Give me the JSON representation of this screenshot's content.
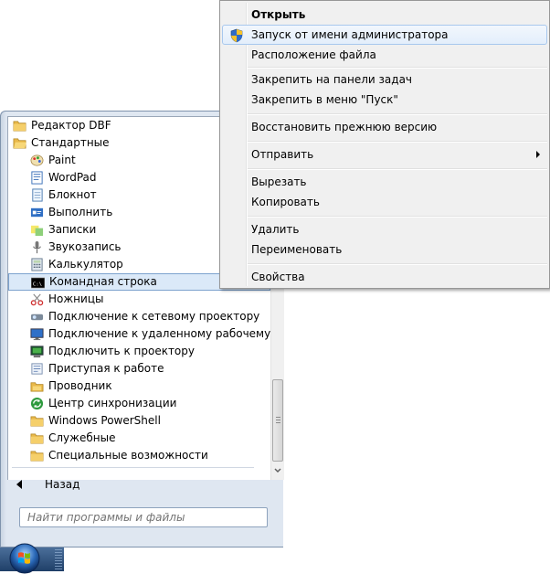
{
  "program_list": {
    "items": [
      {
        "label": "Редактор DBF",
        "kind": "folder",
        "icon": "folder-icon"
      },
      {
        "label": "Стандартные",
        "kind": "folder",
        "icon": "folder-open-icon"
      },
      {
        "label": "Paint",
        "kind": "app",
        "icon": "paint-icon"
      },
      {
        "label": "WordPad",
        "kind": "app",
        "icon": "wordpad-icon"
      },
      {
        "label": "Блокнот",
        "kind": "app",
        "icon": "notepad-icon"
      },
      {
        "label": "Выполнить",
        "kind": "app",
        "icon": "run-icon"
      },
      {
        "label": "Записки",
        "kind": "app",
        "icon": "sticky-notes-icon"
      },
      {
        "label": "Звукозапись",
        "kind": "app",
        "icon": "microphone-icon"
      },
      {
        "label": "Калькулятор",
        "kind": "app",
        "icon": "calculator-icon"
      },
      {
        "label": "Командная строка",
        "kind": "app",
        "icon": "cmd-icon",
        "selected": true
      },
      {
        "label": "Ножницы",
        "kind": "app",
        "icon": "scissors-icon"
      },
      {
        "label": "Подключение к сетевому проектору",
        "kind": "app",
        "icon": "projector-network-icon"
      },
      {
        "label": "Подключение к удаленному рабочему столу",
        "kind": "app",
        "icon": "remote-desktop-icon"
      },
      {
        "label": "Подключить к проектору",
        "kind": "app",
        "icon": "projector-icon"
      },
      {
        "label": "Приступая к работе",
        "kind": "app",
        "icon": "getting-started-icon"
      },
      {
        "label": "Проводник",
        "kind": "app",
        "icon": "explorer-icon"
      },
      {
        "label": "Центр синхронизации",
        "kind": "app",
        "icon": "sync-center-icon"
      },
      {
        "label": "Windows PowerShell",
        "kind": "app",
        "icon": "folder-icon"
      },
      {
        "label": "Служебные",
        "kind": "app",
        "icon": "folder-icon"
      },
      {
        "label": "Специальные возможности",
        "kind": "app",
        "icon": "folder-icon"
      }
    ]
  },
  "back_label": "Назад",
  "search": {
    "placeholder": "Найти программы и файлы"
  },
  "context_menu": {
    "items": [
      {
        "label": "Открыть",
        "default": true
      },
      {
        "label": "Запуск от имени администратора",
        "icon": "uac-shield-icon",
        "highlighted": true
      },
      {
        "label": "Расположение файла"
      },
      {
        "separator": true
      },
      {
        "label": "Закрепить на панели задач"
      },
      {
        "label": "Закрепить в меню \"Пуск\""
      },
      {
        "separator": true
      },
      {
        "label": "Восстановить прежнюю версию"
      },
      {
        "separator": true
      },
      {
        "label": "Отправить",
        "submenu": true
      },
      {
        "separator": true
      },
      {
        "label": "Вырезать"
      },
      {
        "label": "Копировать"
      },
      {
        "separator": true
      },
      {
        "label": "Удалить"
      },
      {
        "label": "Переименовать"
      },
      {
        "separator": true
      },
      {
        "label": "Свойства"
      }
    ]
  },
  "colors": {
    "selection_bg": "#dbe9f8",
    "selection_border": "#7da2ce",
    "menu_bg": "#f0f0f0",
    "start_menu_bg": "#dfe7f1",
    "taskbar": "#1f3f68"
  }
}
